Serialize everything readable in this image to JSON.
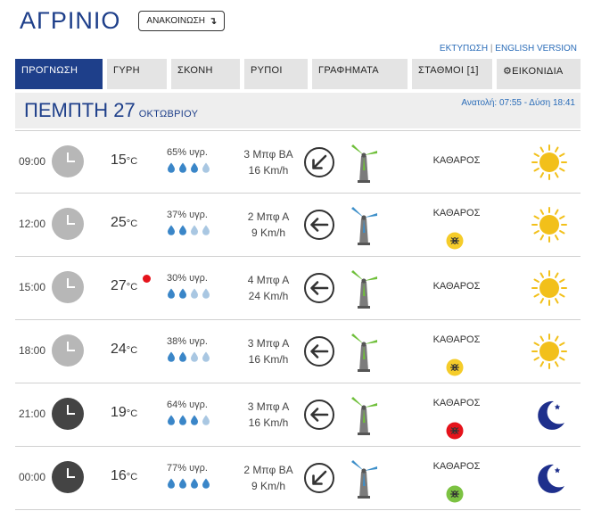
{
  "header": {
    "city": "ΑΓΡΙΝΙΟ",
    "announce_label": "ΑΝΑΚΟΙΝΩΣΗ",
    "announce_arrow": "↴"
  },
  "links": {
    "print": "ΕΚΤΥΠΩΣΗ",
    "separator": " | ",
    "english": "ENGLISH VERSION"
  },
  "tabs": [
    {
      "label": "ΠΡΟΓΝΩΣΗ",
      "active": true
    },
    {
      "label": "ΓΥΡΗ"
    },
    {
      "label": "ΣΚΟΝΗ"
    },
    {
      "label": "ΡΥΠΟΙ"
    },
    {
      "label": "ΓΡΑΦΗΜΑΤΑ"
    },
    {
      "label": "ΣΤΑΘΜΟΙ [1]"
    },
    {
      "label": "ΕΙΚΟΝΙΔΙΑ",
      "icon": "gear-icon"
    }
  ],
  "day": {
    "title": "ΠΕΜΠΤΗ 27",
    "month": "ΟΚΤΩΒΡΙΟΥ",
    "sun": "Ανατολή: 07:55 - Δύση 18:41"
  },
  "colors": {
    "brand": "#1e3f8a",
    "link": "#2a6cb8",
    "tab_bg": "#e4e4e4",
    "drop_full": "#3a86c8",
    "drop_empty": "#a9c7e2",
    "sun": "#f2c01a",
    "moon": "#1e2f8c",
    "turbine_green": "#6fbf3a",
    "turbine_blue": "#3d8fc9",
    "dust_yellow": "#f5cc2a",
    "dust_red": "#e5131b",
    "dust_green": "#7cc242",
    "alert": "#e5131b"
  },
  "forecast": [
    {
      "time": "09:00",
      "temp": "15",
      "unit": "°C",
      "humidity": "65% υγρ.",
      "drops_filled": 3,
      "wind_force": "3 Μπφ ΒΑ",
      "wind_speed": "16 Km/h",
      "wind_arrow": "south-west",
      "turbine": "green",
      "condition": "ΚΑΘΑΡΟΣ",
      "dust": null,
      "icon": "sun-icon",
      "period": "day",
      "alert": false
    },
    {
      "time": "12:00",
      "temp": "25",
      "unit": "°C",
      "humidity": "37% υγρ.",
      "drops_filled": 2,
      "wind_force": "2 Μπφ Α",
      "wind_speed": "9 Km/h",
      "wind_arrow": "west",
      "turbine": "blue",
      "condition": "ΚΑΘΑΡΟΣ",
      "dust": "yellow",
      "icon": "sun-icon",
      "period": "day",
      "alert": false
    },
    {
      "time": "15:00",
      "temp": "27",
      "unit": "°C",
      "humidity": "30% υγρ.",
      "drops_filled": 2,
      "wind_force": "4 Μπφ Α",
      "wind_speed": "24 Km/h",
      "wind_arrow": "west",
      "turbine": "green",
      "condition": "ΚΑΘΑΡΟΣ",
      "dust": null,
      "icon": "sun-icon",
      "period": "day",
      "alert": true
    },
    {
      "time": "18:00",
      "temp": "24",
      "unit": "°C",
      "humidity": "38% υγρ.",
      "drops_filled": 2,
      "wind_force": "3 Μπφ Α",
      "wind_speed": "16 Km/h",
      "wind_arrow": "west",
      "turbine": "green",
      "condition": "ΚΑΘΑΡΟΣ",
      "dust": "yellow",
      "icon": "sun-icon",
      "period": "day",
      "alert": false
    },
    {
      "time": "21:00",
      "temp": "19",
      "unit": "°C",
      "humidity": "64% υγρ.",
      "drops_filled": 3,
      "wind_force": "3 Μπφ Α",
      "wind_speed": "16 Km/h",
      "wind_arrow": "west",
      "turbine": "green",
      "condition": "ΚΑΘΑΡΟΣ",
      "dust": "red",
      "icon": "moon-icon",
      "period": "night",
      "alert": false
    },
    {
      "time": "00:00",
      "temp": "16",
      "unit": "°C",
      "humidity": "77% υγρ.",
      "drops_filled": 4,
      "wind_force": "2 Μπφ ΒΑ",
      "wind_speed": "9 Km/h",
      "wind_arrow": "south-west",
      "turbine": "blue",
      "condition": "ΚΑΘΑΡΟΣ",
      "dust": "green",
      "icon": "moon-icon",
      "period": "night",
      "alert": false
    }
  ]
}
